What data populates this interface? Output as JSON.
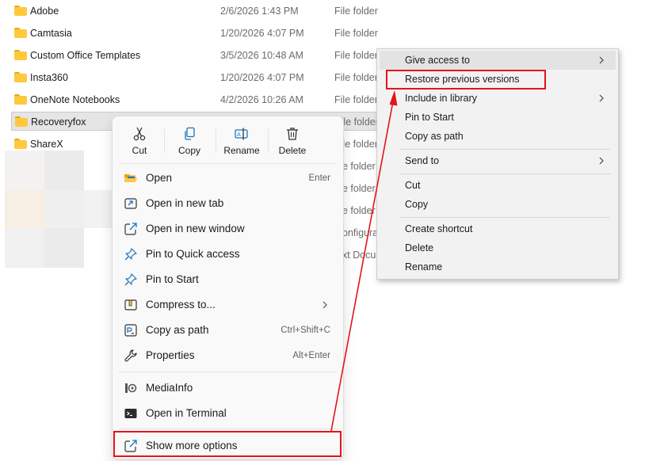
{
  "files": [
    {
      "name": "Adobe",
      "date": "2/6/2026 1:43 PM",
      "type": "File folder"
    },
    {
      "name": "Camtasia",
      "date": "1/20/2026 4:07 PM",
      "type": "File folder"
    },
    {
      "name": "Custom Office Templates",
      "date": "3/5/2026 10:48 AM",
      "type": "File folder"
    },
    {
      "name": "Insta360",
      "date": "1/20/2026 4:07 PM",
      "type": "File folder"
    },
    {
      "name": "OneNote Notebooks",
      "date": "4/2/2026 10:26 AM",
      "type": "File folder"
    },
    {
      "name": "Recoveryfox",
      "date": "",
      "type": "File folder"
    },
    {
      "name": "ShareX",
      "date": "",
      "type": "File folder"
    }
  ],
  "partial_rows": [
    "e folder",
    "e folder",
    "e folder",
    "e folder",
    "onfigurat",
    "xt Docu"
  ],
  "w11_menu": {
    "quick_actions": [
      {
        "label": "Cut",
        "icon": "scissors-icon"
      },
      {
        "label": "Copy",
        "icon": "copy-icon"
      },
      {
        "label": "Rename",
        "icon": "rename-icon"
      },
      {
        "label": "Delete",
        "icon": "trash-icon"
      }
    ],
    "items": [
      {
        "label": "Open",
        "shortcut": "Enter",
        "icon": "folder-open-icon"
      },
      {
        "label": "Open in new tab",
        "icon": "new-tab-icon"
      },
      {
        "label": "Open in new window",
        "icon": "new-window-icon"
      },
      {
        "label": "Pin to Quick access",
        "icon": "pin-icon"
      },
      {
        "label": "Pin to Start",
        "icon": "pin-icon"
      },
      {
        "label": "Compress to...",
        "icon": "zip-icon",
        "submenu": true
      },
      {
        "label": "Copy as path",
        "shortcut": "Ctrl+Shift+C",
        "icon": "copy-path-icon"
      },
      {
        "label": "Properties",
        "shortcut": "Alt+Enter",
        "icon": "wrench-icon"
      },
      {
        "label": "MediaInfo",
        "icon": "mediainfo-icon"
      },
      {
        "label": "Open in Terminal",
        "icon": "terminal-icon"
      },
      {
        "label": "Show more options",
        "icon": "external-icon"
      }
    ]
  },
  "classic_menu": {
    "items": [
      {
        "label": "Give access to",
        "submenu": true
      },
      {
        "label": "Restore previous versions"
      },
      {
        "label": "Include in library",
        "submenu": true
      },
      {
        "label": "Pin to Start"
      },
      {
        "label": "Copy as path"
      },
      {
        "label": "Send to",
        "submenu": true
      },
      {
        "label": "Cut"
      },
      {
        "label": "Copy"
      },
      {
        "label": "Create shortcut"
      },
      {
        "label": "Delete"
      },
      {
        "label": "Rename"
      }
    ]
  },
  "colors": {
    "annotation": "#e3141c",
    "folder": "#ffc83d",
    "accent": "#005fb8"
  }
}
